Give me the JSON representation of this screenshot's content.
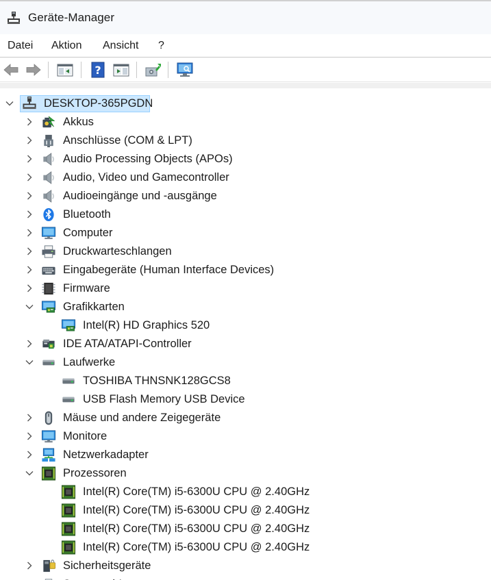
{
  "window": {
    "title": "Geräte-Manager"
  },
  "menu": {
    "file": "Datei",
    "action": "Aktion",
    "view": "Ansicht",
    "help": "?"
  },
  "toolbar": {
    "icons": [
      "back-icon",
      "forward-icon",
      "properties-pane-icon",
      "help-icon",
      "action-pane-icon",
      "update-driver-icon",
      "scan-hardware-icon"
    ]
  },
  "tree": {
    "root": "DESKTOP-365PGDN",
    "categories": [
      {
        "label": "Akkus",
        "icon": "battery-icon",
        "expanded": false,
        "children": []
      },
      {
        "label": "Anschlüsse (COM & LPT)",
        "icon": "port-icon",
        "expanded": false,
        "children": []
      },
      {
        "label": "Audio Processing Objects (APOs)",
        "icon": "speaker-icon",
        "expanded": false,
        "children": []
      },
      {
        "label": "Audio, Video und Gamecontroller",
        "icon": "speaker-icon",
        "expanded": false,
        "children": []
      },
      {
        "label": "Audioeingänge und -ausgänge",
        "icon": "speaker-icon",
        "expanded": false,
        "children": []
      },
      {
        "label": "Bluetooth",
        "icon": "bluetooth-icon",
        "expanded": false,
        "children": []
      },
      {
        "label": "Computer",
        "icon": "monitor-icon",
        "expanded": false,
        "children": []
      },
      {
        "label": "Druckwarteschlangen",
        "icon": "printer-icon",
        "expanded": false,
        "children": []
      },
      {
        "label": "Eingabegeräte (Human Interface Devices)",
        "icon": "keyboard-icon",
        "expanded": false,
        "children": []
      },
      {
        "label": "Firmware",
        "icon": "firmware-chip-icon",
        "expanded": false,
        "children": []
      },
      {
        "label": "Grafikkarten",
        "icon": "display-adapter-icon",
        "expanded": true,
        "children": [
          {
            "label": "Intel(R) HD Graphics 520",
            "icon": "display-adapter-icon"
          }
        ]
      },
      {
        "label": "IDE ATA/ATAPI-Controller",
        "icon": "ide-controller-icon",
        "expanded": false,
        "children": []
      },
      {
        "label": "Laufwerke",
        "icon": "drive-icon",
        "expanded": true,
        "children": [
          {
            "label": "TOSHIBA THNSNK128GCS8",
            "icon": "drive-icon"
          },
          {
            "label": "USB Flash Memory USB Device",
            "icon": "drive-icon"
          }
        ]
      },
      {
        "label": "Mäuse und andere Zeigegeräte",
        "icon": "mouse-icon",
        "expanded": false,
        "children": []
      },
      {
        "label": "Monitore",
        "icon": "monitor-icon",
        "expanded": false,
        "children": []
      },
      {
        "label": "Netzwerkadapter",
        "icon": "network-adapter-icon",
        "expanded": false,
        "children": []
      },
      {
        "label": "Prozessoren",
        "icon": "processor-icon",
        "expanded": true,
        "children": [
          {
            "label": "Intel(R) Core(TM) i5-6300U CPU @ 2.40GHz",
            "icon": "processor-icon"
          },
          {
            "label": "Intel(R) Core(TM) i5-6300U CPU @ 2.40GHz",
            "icon": "processor-icon"
          },
          {
            "label": "Intel(R) Core(TM) i5-6300U CPU @ 2.40GHz",
            "icon": "processor-icon"
          },
          {
            "label": "Intel(R) Core(TM) i5-6300U CPU @ 2.40GHz",
            "icon": "processor-icon"
          }
        ]
      },
      {
        "label": "Sicherheitsgeräte",
        "icon": "security-device-icon",
        "expanded": false,
        "children": []
      },
      {
        "label": "Smartcard-Leser",
        "icon": "smartcard-reader-icon",
        "expanded": false,
        "children": []
      }
    ]
  },
  "colors": {
    "selection": "#cce8ff",
    "selection_border": "#99d1ff",
    "titlebar": "#f7f9fc"
  }
}
